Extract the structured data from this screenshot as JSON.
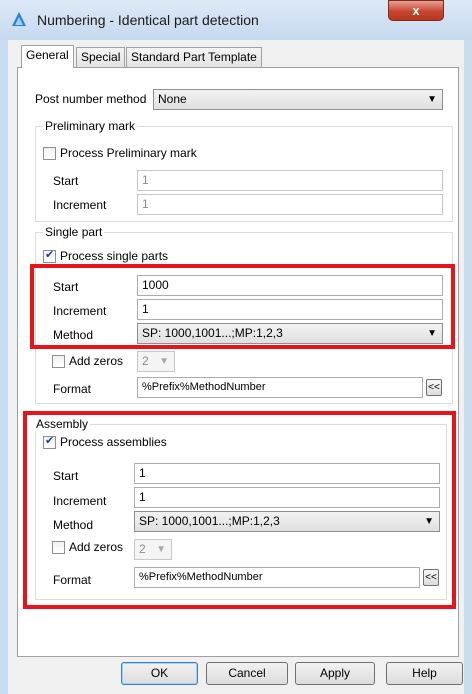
{
  "window": {
    "title": "Numbering - Identical part detection",
    "close_label": "x"
  },
  "tabs": [
    {
      "label": "General"
    },
    {
      "label": "Special"
    },
    {
      "label": "Standard Part Template"
    }
  ],
  "post_number": {
    "label": "Post number method",
    "value": "None"
  },
  "preliminary": {
    "legend": "Preliminary mark",
    "checkbox_label": "Process Preliminary mark",
    "checked": false,
    "start_label": "Start",
    "start_value": "1",
    "increment_label": "Increment",
    "increment_value": "1"
  },
  "single_part": {
    "legend": "Single part",
    "checkbox_label": "Process single parts",
    "checked": true,
    "start_label": "Start",
    "start_value": "1000",
    "increment_label": "Increment",
    "increment_value": "1",
    "method_label": "Method",
    "method_value": "SP: 1000,1001...;MP:1,2,3",
    "add_zeros_label": "Add zeros",
    "add_zeros_checked": false,
    "zeros_value": "2",
    "format_label": "Format",
    "format_value": "%Prefix%MethodNumber",
    "format_button": "<<"
  },
  "assembly": {
    "legend": "Assembly",
    "checkbox_label": "Process assemblies",
    "checked": true,
    "start_label": "Start",
    "start_value": "1",
    "increment_label": "Increment",
    "increment_value": "1",
    "method_label": "Method",
    "method_value": "SP: 1000,1001...;MP:1,2,3",
    "add_zeros_label": "Add zeros",
    "add_zeros_checked": false,
    "zeros_value": "2",
    "format_label": "Format",
    "format_value": "%Prefix%MethodNumber",
    "format_button": "<<"
  },
  "buttons": {
    "ok": "OK",
    "cancel": "Cancel",
    "apply": "Apply",
    "help": "Help"
  },
  "colors": {
    "highlight": "#e8141c",
    "title_bg": "#c9dcf0"
  }
}
